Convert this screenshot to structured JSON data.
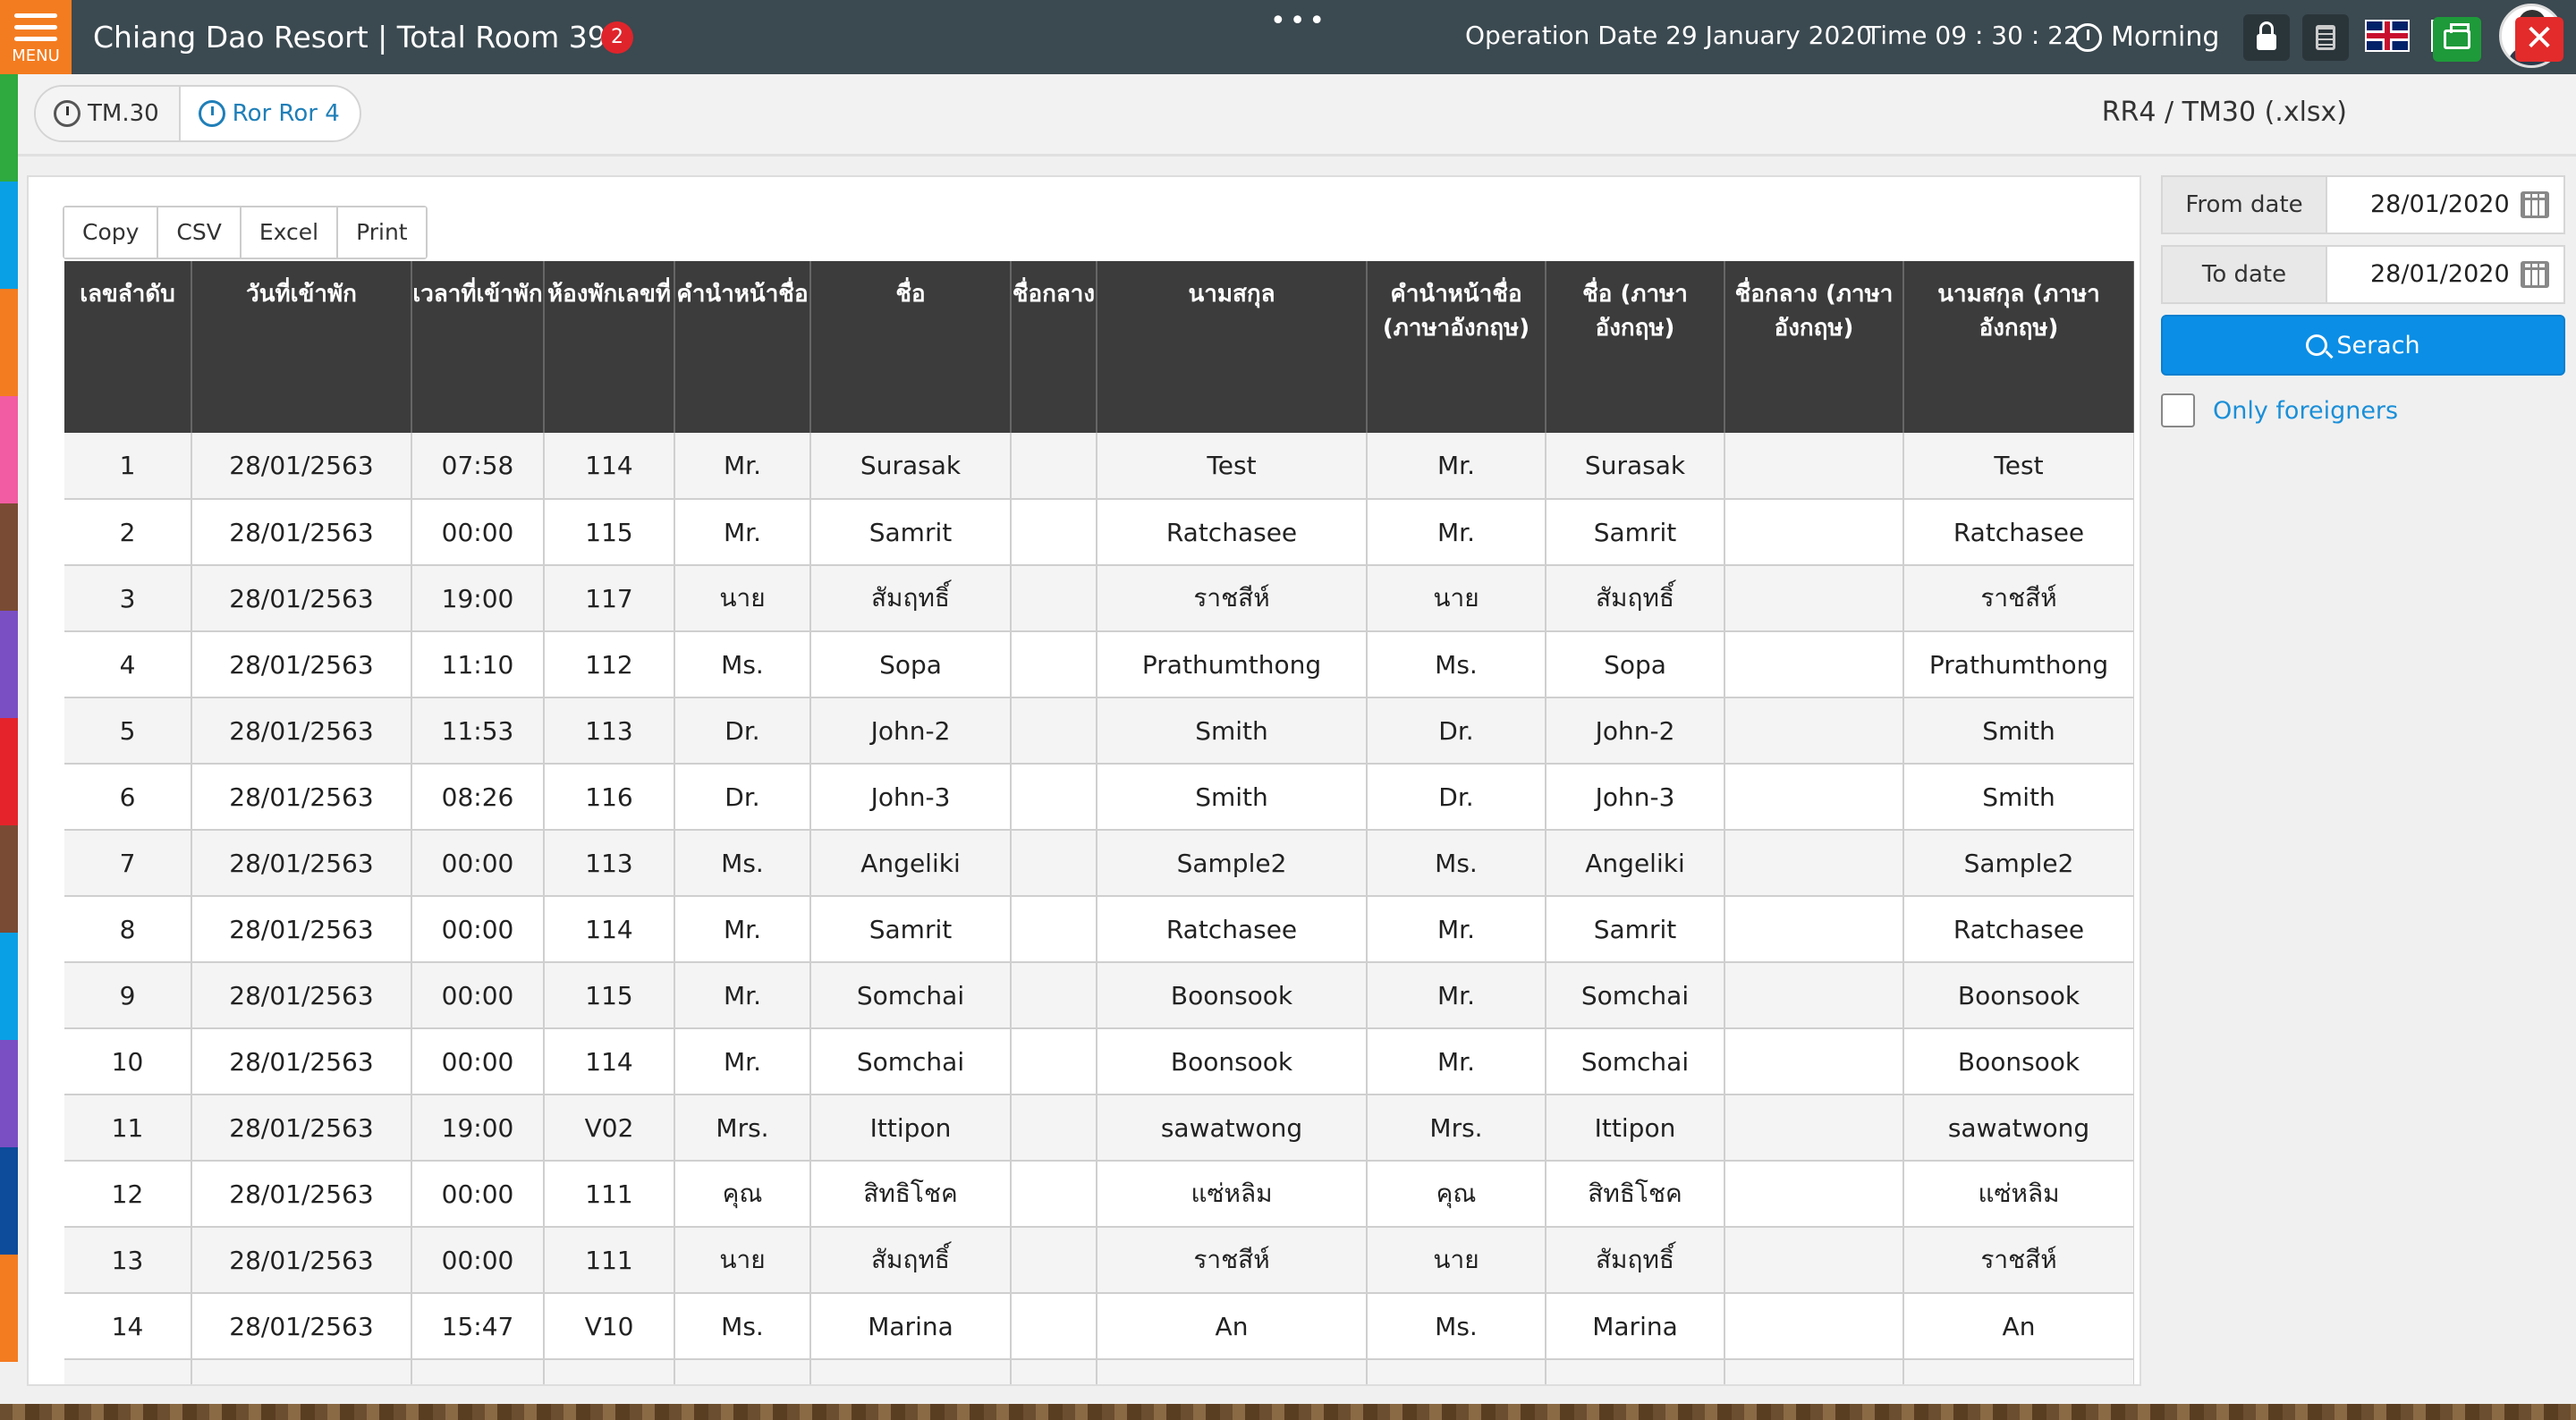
{
  "header": {
    "menu_label": "MENU",
    "title": "Chiang Dao Resort | Total Room 39",
    "notification_count": "2",
    "dots": "•••",
    "operation_date": "Operation Date 29 January 2020",
    "time": "Time 09 : 30 : 22",
    "shift": "Morning"
  },
  "subheader": {
    "tabs": [
      {
        "label": "TM.30"
      },
      {
        "label": "Ror Ror 4"
      }
    ],
    "report_title": "RR4 / TM30 (.xlsx)"
  },
  "export_buttons": [
    "Copy",
    "CSV",
    "Excel",
    "Print"
  ],
  "table": {
    "columns": [
      "เลขลำดับ",
      "วันที่เข้าพัก",
      "เวลาที่เข้าพัก",
      "ห้องพักเลขที่",
      "คำนำหน้าชื่อ",
      "ชื่อ",
      "ชื่อกลาง",
      "นามสกุล",
      "คำนำหน้าชื่อ (ภาษาอังกฤษ)",
      "ชื่อ (ภาษาอังกฤษ)",
      "ชื่อกลาง (ภาษาอังกฤษ)",
      "นามสกุล (ภาษาอังกฤษ)"
    ],
    "rows": [
      [
        "1",
        "28/01/2563",
        "07:58",
        "114",
        "Mr.",
        "Surasak",
        "",
        "Test",
        "Mr.",
        "Surasak",
        "",
        "Test"
      ],
      [
        "2",
        "28/01/2563",
        "00:00",
        "115",
        "Mr.",
        "Samrit",
        "",
        "Ratchasee",
        "Mr.",
        "Samrit",
        "",
        "Ratchasee"
      ],
      [
        "3",
        "28/01/2563",
        "19:00",
        "117",
        "นาย",
        "สัมฤทธิ์",
        "",
        "ราชสีห์",
        "นาย",
        "สัมฤทธิ์",
        "",
        "ราชสีห์"
      ],
      [
        "4",
        "28/01/2563",
        "11:10",
        "112",
        "Ms.",
        "Sopa",
        "",
        "Prathumthong",
        "Ms.",
        "Sopa",
        "",
        "Prathumthong"
      ],
      [
        "5",
        "28/01/2563",
        "11:53",
        "113",
        "Dr.",
        "John-2",
        "",
        "Smith",
        "Dr.",
        "John-2",
        "",
        "Smith"
      ],
      [
        "6",
        "28/01/2563",
        "08:26",
        "116",
        "Dr.",
        "John-3",
        "",
        "Smith",
        "Dr.",
        "John-3",
        "",
        "Smith"
      ],
      [
        "7",
        "28/01/2563",
        "00:00",
        "113",
        "Ms.",
        "Angeliki",
        "",
        "Sample2",
        "Ms.",
        "Angeliki",
        "",
        "Sample2"
      ],
      [
        "8",
        "28/01/2563",
        "00:00",
        "114",
        "Mr.",
        "Samrit",
        "",
        "Ratchasee",
        "Mr.",
        "Samrit",
        "",
        "Ratchasee"
      ],
      [
        "9",
        "28/01/2563",
        "00:00",
        "115",
        "Mr.",
        "Somchai",
        "",
        "Boonsook",
        "Mr.",
        "Somchai",
        "",
        "Boonsook"
      ],
      [
        "10",
        "28/01/2563",
        "00:00",
        "114",
        "Mr.",
        "Somchai",
        "",
        "Boonsook",
        "Mr.",
        "Somchai",
        "",
        "Boonsook"
      ],
      [
        "11",
        "28/01/2563",
        "19:00",
        "V02",
        "Mrs.",
        "Ittipon",
        "",
        "sawatwong",
        "Mrs.",
        "Ittipon",
        "",
        "sawatwong"
      ],
      [
        "12",
        "28/01/2563",
        "00:00",
        "111",
        "คุณ",
        "สิทธิโชค",
        "",
        "แซ่หลิม",
        "คุณ",
        "สิทธิโชค",
        "",
        "แซ่หลิม"
      ],
      [
        "13",
        "28/01/2563",
        "00:00",
        "111",
        "นาย",
        "สัมฤทธิ์",
        "",
        "ราชสีห์",
        "นาย",
        "สัมฤทธิ์",
        "",
        "ราชสีห์"
      ],
      [
        "14",
        "28/01/2563",
        "15:47",
        "V10",
        "Ms.",
        "Marina",
        "",
        "An",
        "Ms.",
        "Marina",
        "",
        "An"
      ]
    ]
  },
  "filter": {
    "from_label": "From date",
    "from_value": "28/01/2020",
    "to_label": "To date",
    "to_value": "28/01/2020",
    "search_label": "Serach",
    "foreigners_label": "Only foreigners"
  },
  "colors": {
    "topbar": "#3b4950",
    "menu": "#f47c20",
    "accent": "#0b8ee6",
    "table_header": "#3c3c3c",
    "strip": [
      "#2eaa3f",
      "#0aa0e6",
      "#f47c20",
      "#f25ca2",
      "#7a4b34",
      "#7b4fc4",
      "#e5232b",
      "#7a4b34",
      "#0aa0e6",
      "#7b4fc4",
      "#0c4c9a",
      "#f47c20"
    ]
  }
}
